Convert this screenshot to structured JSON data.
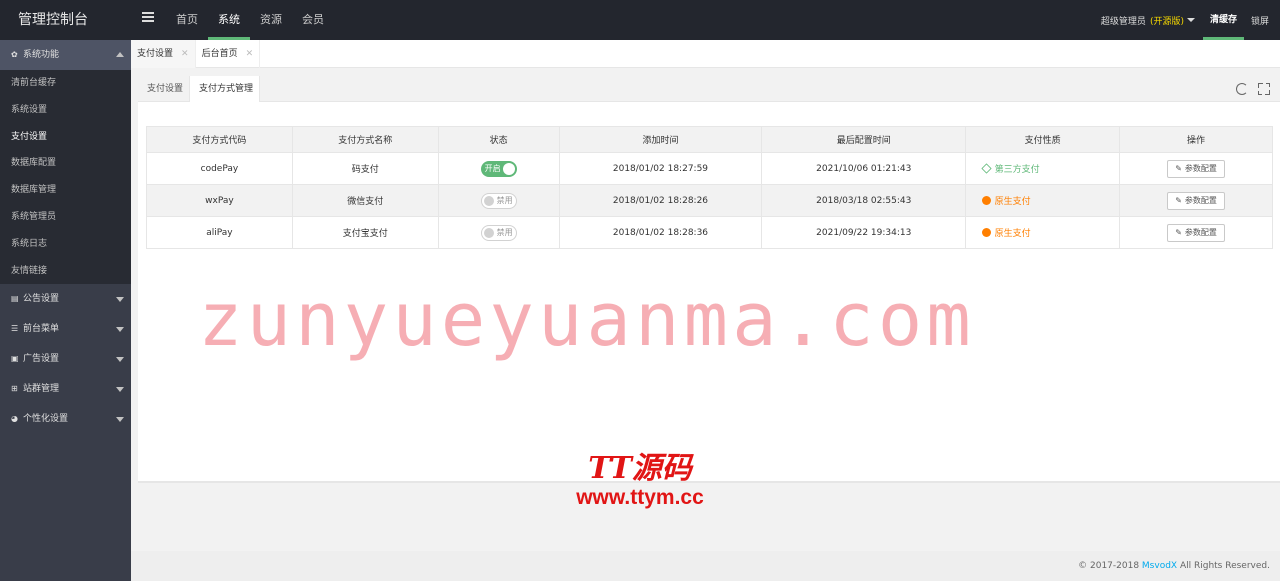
{
  "app": {
    "title": "管理控制台"
  },
  "topnav": {
    "items": [
      {
        "label": "首页"
      },
      {
        "label": "系统"
      },
      {
        "label": "资源"
      },
      {
        "label": "会员"
      }
    ],
    "admin_name": "超级管理员",
    "edition": "(开源版)",
    "clear_cache": "清缓存",
    "lock_screen": "锁屏"
  },
  "sidebar": {
    "system_group": "系统功能",
    "system_items": [
      {
        "label": "清前台缓存"
      },
      {
        "label": "系统设置"
      },
      {
        "label": "支付设置"
      },
      {
        "label": "数据库配置"
      },
      {
        "label": "数据库管理"
      },
      {
        "label": "系统管理员"
      },
      {
        "label": "系统日志"
      },
      {
        "label": "友情链接"
      }
    ],
    "groups": [
      {
        "label": "公告设置",
        "icon": "book-icon"
      },
      {
        "label": "前台菜单",
        "icon": "list-icon"
      },
      {
        "label": "广告设置",
        "icon": "image-icon"
      },
      {
        "label": "站群管理",
        "icon": "sitemap-icon"
      },
      {
        "label": "个性化设置",
        "icon": "dashboard-icon"
      }
    ]
  },
  "page_tabs": [
    {
      "label": "支付设置"
    },
    {
      "label": "后台首页"
    }
  ],
  "panel": {
    "tabs": [
      {
        "label": "支付设置"
      },
      {
        "label": "支付方式管理"
      }
    ]
  },
  "table": {
    "headers": [
      "支付方式代码",
      "支付方式名称",
      "状态",
      "添加时间",
      "最后配置时间",
      "支付性质",
      "操作"
    ],
    "rows": [
      {
        "code": "codePay",
        "name": "码支付",
        "status": "开启",
        "added": "2018/01/02 18:27:59",
        "configured": "2021/10/06 01:21:43",
        "nature": "第三方支付",
        "action": "参数配置"
      },
      {
        "code": "wxPay",
        "name": "微信支付",
        "status": "禁用",
        "added": "2018/01/02 18:28:26",
        "configured": "2018/03/18 02:55:43",
        "nature": "原生支付",
        "action": "参数配置"
      },
      {
        "code": "aliPay",
        "name": "支付宝支付",
        "status": "禁用",
        "added": "2018/01/02 18:28:36",
        "configured": "2021/09/22 19:34:13",
        "nature": "原生支付",
        "action": "参数配置"
      }
    ]
  },
  "watermark": "zunyueyuanma.com",
  "logo": {
    "name": "TT源码",
    "url": "www.ttym.cc"
  },
  "footer": {
    "prefix": "© 2017-2018",
    "brand": "MsvodX",
    "suffix": "All Rights Reserved."
  },
  "colors": {
    "accent": "#5fb878",
    "native": "#ff7f00",
    "sidebar": "#393d49",
    "topbar": "#23262e"
  }
}
